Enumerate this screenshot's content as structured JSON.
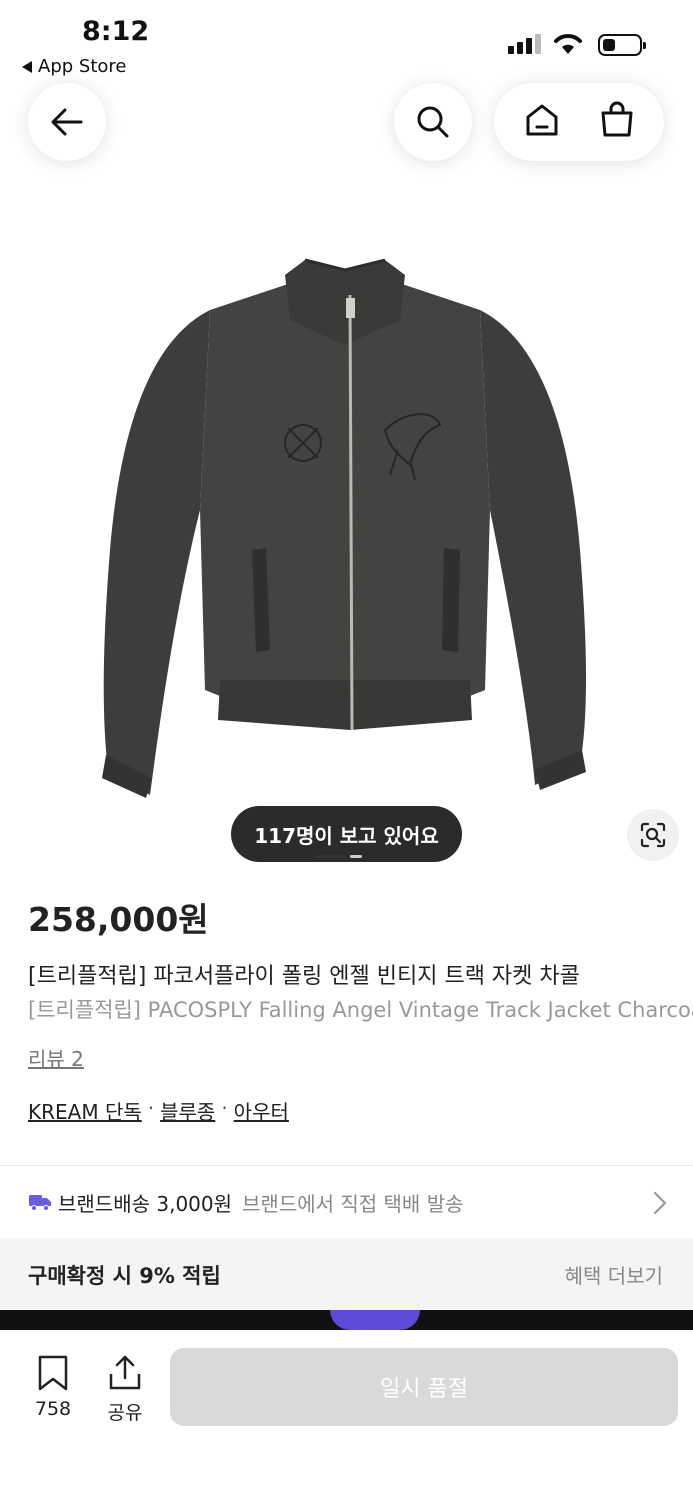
{
  "status_bar": {
    "time": "8:12",
    "back_app": "App Store"
  },
  "nav": {
    "back_icon": "arrow-left-icon",
    "search_icon": "search-icon",
    "home_icon": "home-icon",
    "bag_icon": "shopping-bag-icon"
  },
  "gallery": {
    "viewers_text": "117명이 보고 있어요",
    "lens_icon": "camera-lens-icon"
  },
  "product": {
    "price": "258,000원",
    "title_ko": "[트리플적립] 파코서플라이 폴링 엔젤 빈티지 트랙 자켓 차콜",
    "title_en": "[트리플적립] PACOSPLY Falling Angel Vintage Track Jacket Charcoal",
    "reviews": "리뷰 2",
    "categories": [
      "KREAM 단독",
      "블루종",
      "아우터"
    ],
    "category_separator": "·"
  },
  "shipping": {
    "icon": "truck-icon",
    "label": "브랜드배송 3,000원",
    "detail": "브랜드에서 직접 택배 발송"
  },
  "points": {
    "label": "구매확정 시 9% 적립",
    "more": "혜택 더보기"
  },
  "bottom_bar": {
    "bookmark_count": "758",
    "share_label": "공유",
    "soldout_label": "일시 품절"
  },
  "colors": {
    "accent_truck": "#6b5ce7",
    "viewers_bg": "#2b2b2b",
    "soldout_bg": "#d9d9d9"
  }
}
